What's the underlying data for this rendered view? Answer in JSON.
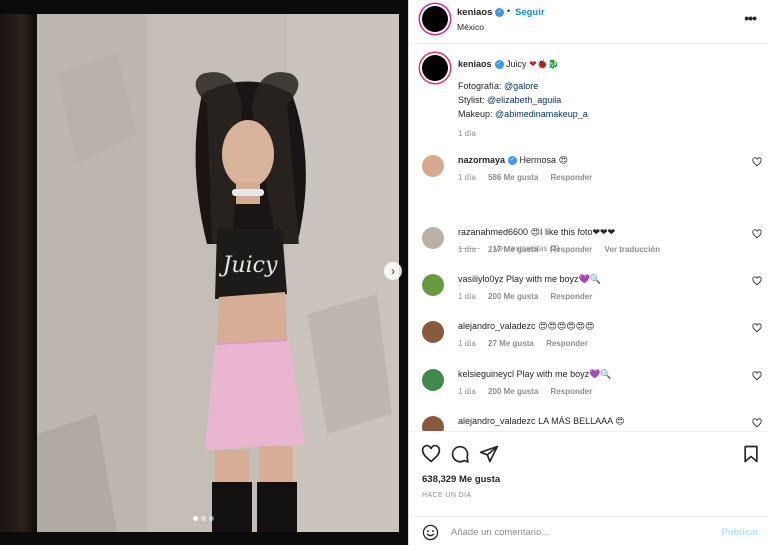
{
  "post": {
    "author": "keniaos",
    "follow_label": "Seguir",
    "dot": "•",
    "location": "México",
    "more_label": "•••"
  },
  "caption": {
    "user": "keniaos",
    "text": "Juicy",
    "emojis": "❤🐞🐉",
    "photo_label": "Fotografía:",
    "photo_handle": "@galore",
    "stylist_label": "Stylist:",
    "stylist_handle": "@elizabeth_aguila",
    "makeup_label": "Makeup:",
    "makeup_handle": "@abimedinamakeup_a",
    "time": "1 día"
  },
  "comments": [
    {
      "user": "nazormaya",
      "verified": true,
      "text": "Hermosa",
      "emoji": "😍",
      "time": "1 día",
      "likes": "586 Me gusta",
      "reply": "Responder",
      "extra": ""
    },
    {
      "user": "razanahmed6600",
      "verified": false,
      "text": "I like this foto",
      "emoji": "😍",
      "suffix": "❤❤❤",
      "time": "1 día",
      "likes": "217 Me gusta",
      "reply": "Responder",
      "extra": "Ver traducción"
    },
    {
      "user": "vasiliylo0yz",
      "verified": false,
      "text": "Play with me boyz",
      "emoji": "💜🔍",
      "time": "1 día",
      "likes": "200 Me gusta",
      "reply": "Responder",
      "extra": ""
    },
    {
      "user": "alejandro_valadezc",
      "verified": false,
      "text": "",
      "emoji": "😍😍😍😍😍😍",
      "time": "1 día",
      "likes": "27 Me gusta",
      "reply": "Responder",
      "extra": ""
    },
    {
      "user": "kelsieguineycl",
      "verified": false,
      "text": "Play with me boyz",
      "emoji": "💜🔍",
      "time": "1 día",
      "likes": "200 Me gusta",
      "reply": "Responder",
      "extra": ""
    },
    {
      "user": "alejandro_valadezc",
      "verified": false,
      "text": "LA MÁS BELLAAA",
      "emoji": "😍",
      "time": "",
      "likes": "",
      "reply": "",
      "extra": ""
    }
  ],
  "view_replies": "Ver respuestas (3)",
  "icons": [
    "heart-icon",
    "comment-icon",
    "share-icon",
    "bookmark-icon",
    "emoji-icon",
    "chevron-right-icon",
    "more-icon"
  ],
  "likes_total": "638,329 Me gusta",
  "posted_ago": "Hace un día",
  "add_comment_placeholder": "Añade un comentario...",
  "publish_label": "Publicar",
  "media": {
    "slides": 3,
    "active_slide": 1,
    "next_arrow": "›"
  },
  "photo_text": "Juicy",
  "colors": {
    "link": "#00376b",
    "follow": "#0095f6",
    "muted": "#8e8e8e",
    "publish_disabled": "#b2dffc"
  }
}
